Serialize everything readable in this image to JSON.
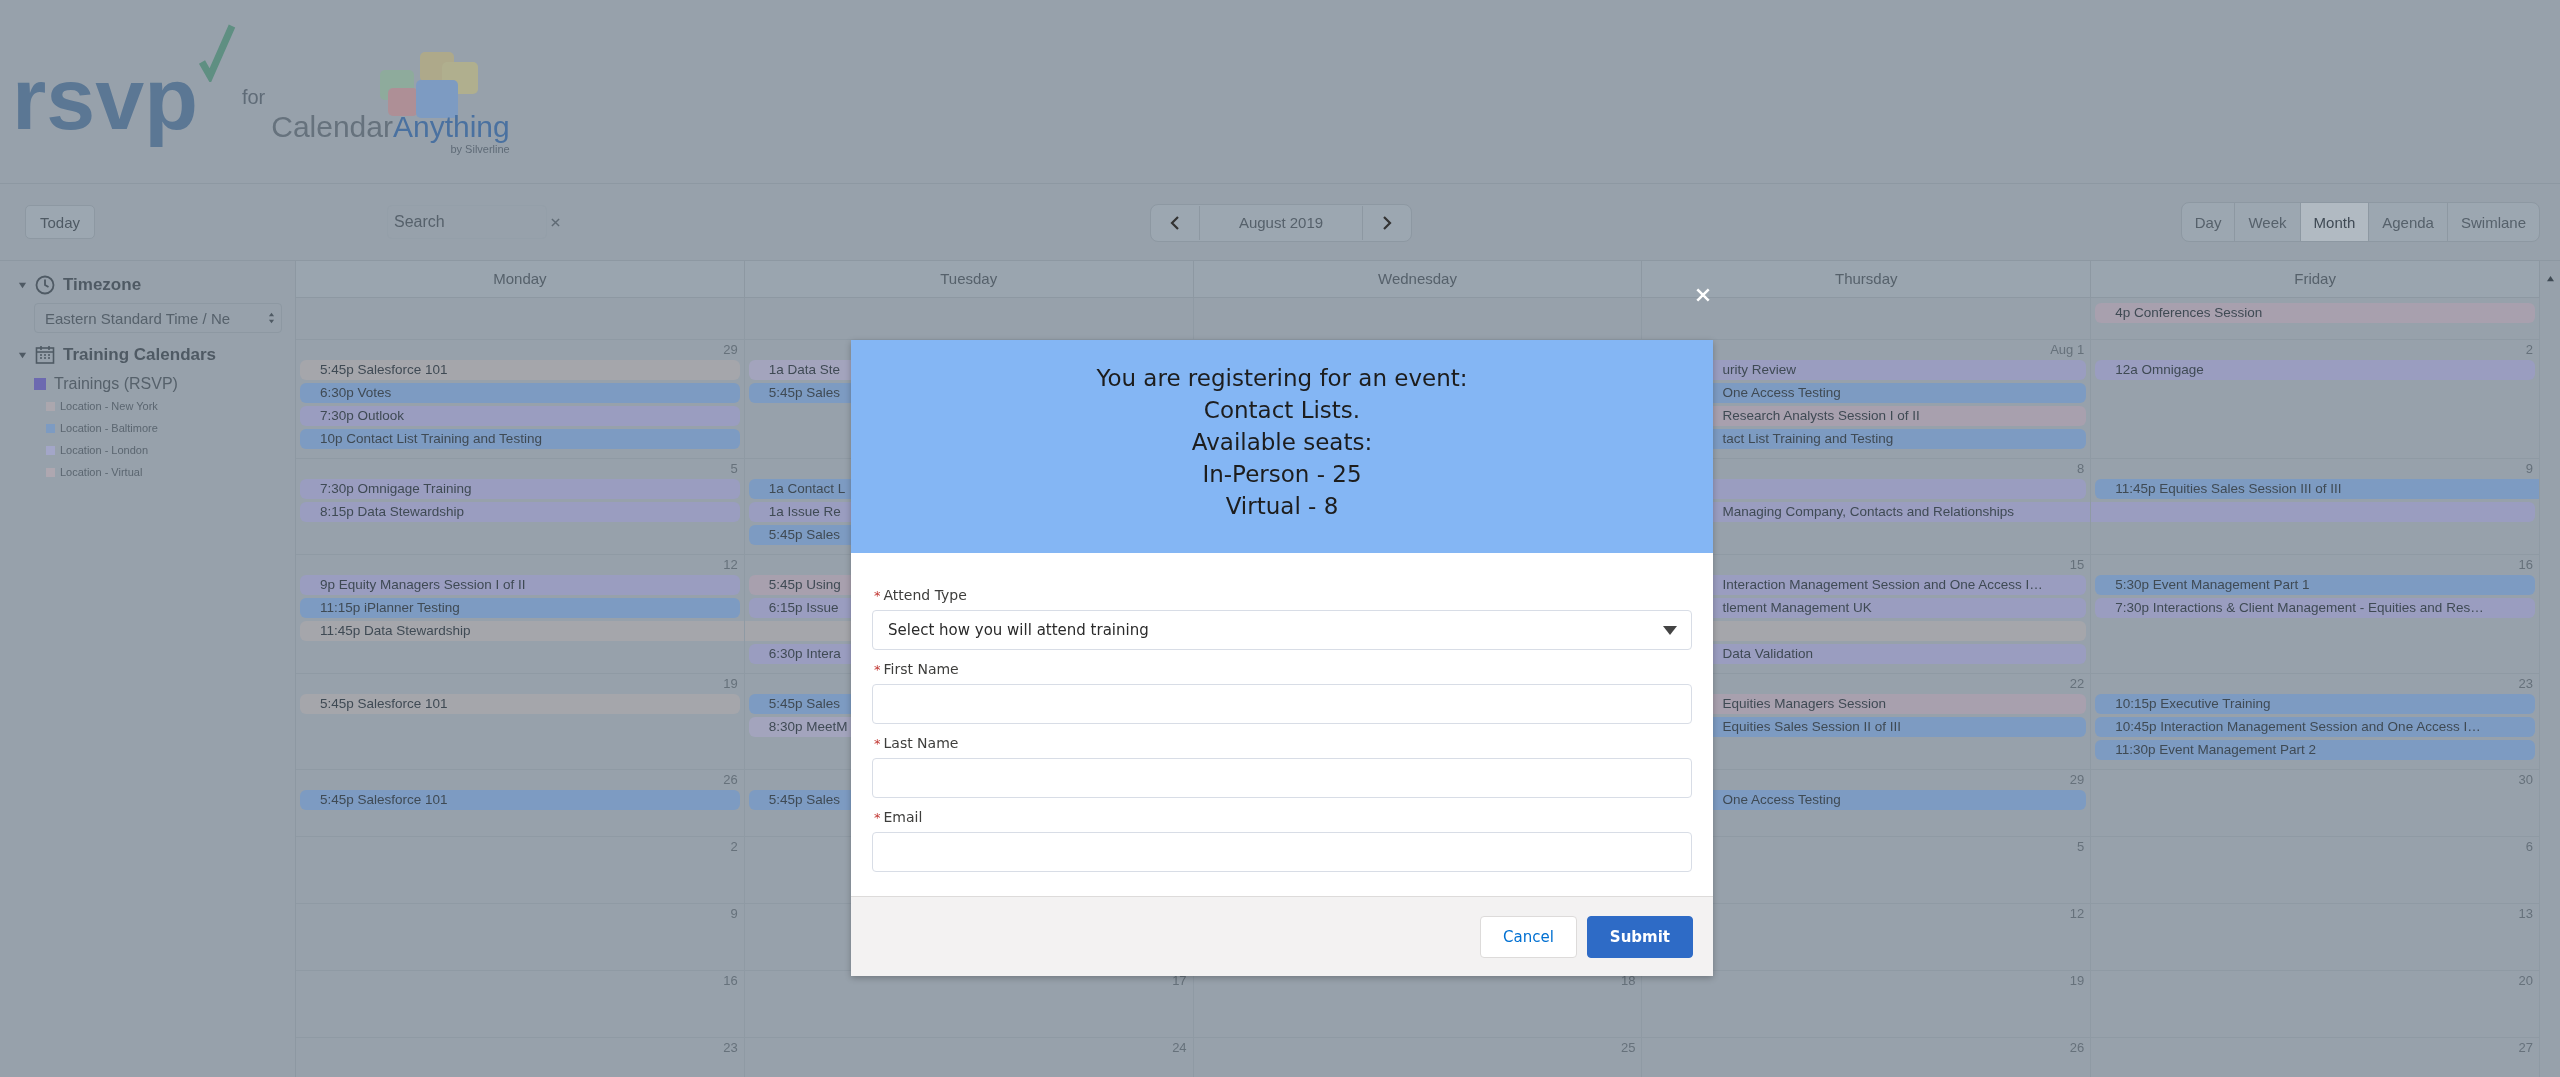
{
  "header": {
    "logo": {
      "wordmark": "rsvp",
      "connector": "for",
      "product_light": "Calendar",
      "product_bold": "Anything",
      "byline": "by Silverline"
    }
  },
  "toolbar": {
    "today": "Today",
    "search": {
      "placeholder": "Search"
    },
    "month_nav": {
      "label": "August 2019"
    },
    "views": [
      {
        "label": "Day",
        "selected": false
      },
      {
        "label": "Week",
        "selected": false
      },
      {
        "label": "Month",
        "selected": true
      },
      {
        "label": "Agenda",
        "selected": false
      },
      {
        "label": "Swimlane",
        "selected": false
      }
    ]
  },
  "sidebar": {
    "sections": [
      {
        "kind": "timezone",
        "title": "Timezone",
        "expanded": true,
        "select_value": "Eastern Standard Time / Ne"
      },
      {
        "kind": "calendars",
        "title": "Training Calendars",
        "expanded": true,
        "items": [
          {
            "label": "Trainings (RSVP)",
            "color": "#6c69b0",
            "children": [
              {
                "label": "Location - New York",
                "color": "#aba7ae"
              },
              {
                "label": "Location - Baltimore",
                "color": "#7d9bc2"
              },
              {
                "label": "Location - London",
                "color": "#a3a6c8"
              },
              {
                "label": "Location - Virtual",
                "color": "#aea7b0"
              }
            ]
          }
        ]
      }
    ]
  },
  "calendar": {
    "days": [
      "Monday",
      "Tuesday",
      "Wednesday",
      "Thursday",
      "Friday"
    ],
    "weeks": [
      {
        "cells": [
          {},
          {},
          {},
          {},
          {
            "events": [
              {
                "title": "4p Conferences Session",
                "color": "#a8a0ae",
                "continues_left": false,
                "continues_right": false
              }
            ]
          }
        ]
      },
      {
        "cells": [
          {
            "date": "29",
            "events": [
              {
                "title": "5:45p Salesforce 101",
                "color": "#a5a6ab",
                "continues_left": false,
                "continues_right": false
              },
              {
                "title": "6:30p Votes",
                "color": "#7d9bc2",
                "continues_left": false,
                "continues_right": false
              },
              {
                "title": "7:30p Outlook",
                "color": "#9a9dc0",
                "continues_left": false,
                "continues_right": false
              },
              {
                "title": "10p Contact List Training and Testing",
                "color": "#7d9bc2",
                "continues_left": false,
                "continues_right": false
              }
            ]
          },
          {
            "events": [
              {
                "title": "1a Data Ste",
                "color": "#a3a4bd",
                "continues_left": false,
                "continues_right": false
              },
              {
                "title": "5:45p Sales",
                "color": "#7d9bc2",
                "continues_left": false,
                "continues_right": false
              }
            ]
          },
          {},
          {
            "date": "Aug 1",
            "events": [
              {
                "title": "urity Review",
                "color": "#9a9dc0",
                "continues_left": false,
                "continues_right": false
              },
              {
                "title": "One Access Testing",
                "color": "#7d9bc2",
                "continues_left": false,
                "continues_right": false
              },
              {
                "title": "Research Analysts Session I of II",
                "color": "#a8a0ae",
                "continues_left": false,
                "continues_right": false
              },
              {
                "title": "tact List Training and Testing",
                "color": "#7d9bc2",
                "continues_left": false,
                "continues_right": false
              }
            ]
          },
          {
            "date": "2",
            "events": [
              {
                "title": "12a Omnigage",
                "color": "#9a9dc0",
                "continues_left": false,
                "continues_right": false
              }
            ]
          }
        ]
      },
      {
        "cells": [
          {
            "date": "5",
            "events": [
              {
                "title": "7:30p Omnigage Training",
                "color": "#9a9dc0",
                "continues_left": false,
                "continues_right": false
              },
              {
                "title": "8:15p Data Stewardship",
                "color": "#9a9dc0",
                "continues_left": false,
                "continues_right": false
              }
            ]
          },
          {
            "events": [
              {
                "title": "1a Contact L",
                "color": "#7d9bc2",
                "continues_left": false,
                "continues_right": false
              },
              {
                "title": "1a Issue Re",
                "color": "#9a9dc0",
                "continues_left": false,
                "continues_right": false
              },
              {
                "title": "5:45p Sales",
                "color": "#7d9bc2",
                "continues_left": false,
                "continues_right": false
              }
            ]
          },
          {},
          {
            "date": "8",
            "events": [
              {
                "color": "#9a9dc0",
                "continues_left": false,
                "continues_right": false
              },
              {
                "title": "Managing Company, Contacts and Relationships",
                "color": "#9a9dc0",
                "continues_left": false,
                "continues_right": true
              }
            ]
          },
          {
            "date": "9",
            "events": [
              {
                "title": "11:45p Equities Sales Session III of III",
                "color": "#7d9bc2",
                "continues_left": false,
                "continues_right": true
              },
              {
                "color": "#9a9dc0",
                "continues_left": true,
                "continues_right": false
              }
            ]
          }
        ]
      },
      {
        "cells": [
          {
            "date": "12",
            "events": [
              {
                "title": "9p Equity Managers Session I of II",
                "color": "#9a9dc0",
                "continues_left": false,
                "continues_right": false
              },
              {
                "title": "11:15p iPlanner Testing",
                "color": "#7d9bc2",
                "continues_left": false,
                "continues_right": false
              },
              {
                "title": "11:45p Data Stewardship",
                "color": "#a5a6ab",
                "continues_left": false,
                "continues_right": true
              }
            ]
          },
          {
            "events": [
              {
                "title": "5:45p Using",
                "color": "#a8a0ae",
                "continues_left": false,
                "continues_right": false
              },
              {
                "title": "6:15p Issue",
                "color": "#9a9dc0",
                "continues_left": false,
                "continues_right": false
              },
              {
                "color": "#a5a6ab",
                "continues_left": true,
                "continues_right": true
              },
              {
                "title": "6:30p Intera",
                "color": "#9a9dc0",
                "continues_left": false,
                "continues_right": false
              }
            ]
          },
          {},
          {
            "date": "15",
            "events": [
              {
                "title": "Interaction Management Session and One Access I…",
                "color": "#9a9dc0",
                "continues_left": false,
                "continues_right": false
              },
              {
                "title": "tlement Management UK",
                "color": "#9a9dc0",
                "continues_left": false,
                "continues_right": false
              },
              {
                "color": "#a5a6ab",
                "continues_left": true,
                "continues_right": false
              },
              {
                "title": "Data Validation",
                "color": "#9a9dc0",
                "continues_left": false,
                "continues_right": false
              }
            ]
          },
          {
            "date": "16",
            "events": [
              {
                "title": "5:30p Event Management Part 1",
                "color": "#7d9bc2",
                "continues_left": false,
                "continues_right": false
              },
              {
                "title": "7:30p Interactions & Client Management - Equities and Res…",
                "color": "#9a9dc0",
                "continues_left": false,
                "continues_right": false
              }
            ]
          }
        ]
      },
      {
        "cells": [
          {
            "date": "19",
            "events": [
              {
                "title": "5:45p Salesforce 101",
                "color": "#a5a6ab",
                "continues_left": false,
                "continues_right": false
              }
            ]
          },
          {
            "events": [
              {
                "title": "5:45p Sales",
                "color": "#7d9bc2",
                "continues_left": false,
                "continues_right": false
              },
              {
                "title": "8:30p MeetM",
                "color": "#a3a4bd",
                "continues_left": false,
                "continues_right": false
              }
            ]
          },
          {},
          {
            "date": "22",
            "events": [
              {
                "title": "Equities Managers Session",
                "color": "#a8a0ae",
                "continues_left": false,
                "continues_right": false
              },
              {
                "title": "Equities Sales Session II of III",
                "color": "#7d9bc2",
                "continues_left": false,
                "continues_right": false
              }
            ]
          },
          {
            "date": "23",
            "events": [
              {
                "title": "10:15p Executive Training",
                "color": "#7d9bc2",
                "continues_left": false,
                "continues_right": false
              },
              {
                "title": "10:45p Interaction Management Session and One Access I…",
                "color": "#7d9bc2",
                "continues_left": false,
                "continues_right": false
              },
              {
                "title": "11:30p Event Management Part 2",
                "color": "#7d9bc2",
                "continues_left": false,
                "continues_right": false
              }
            ]
          }
        ]
      },
      {
        "cells": [
          {
            "date": "26",
            "events": [
              {
                "title": "5:45p Salesforce 101",
                "color": "#7d9bc2",
                "continues_left": false,
                "continues_right": false
              }
            ]
          },
          {
            "events": [
              {
                "title": "5:45p Sales",
                "color": "#7d9bc2",
                "continues_left": false,
                "continues_right": false
              }
            ]
          },
          {},
          {
            "date": "29",
            "events": [
              {
                "title": "One Access Testing",
                "color": "#7d9bc2",
                "continues_left": false,
                "continues_right": false
              }
            ]
          },
          {
            "date": "30"
          }
        ]
      },
      {
        "cells": [
          {
            "date": "2"
          },
          {},
          {},
          {
            "date": "5"
          },
          {
            "date": "6"
          }
        ]
      },
      {
        "cells": [
          {
            "date": "9"
          },
          {},
          {},
          {
            "date": "12"
          },
          {
            "date": "13"
          }
        ]
      },
      {
        "cells": [
          {
            "date": "16"
          },
          {
            "date": "17"
          },
          {
            "date": "18"
          },
          {
            "date": "19"
          },
          {
            "date": "20"
          }
        ]
      },
      {
        "cells": [
          {
            "date": "23"
          },
          {
            "date": "24"
          },
          {
            "date": "25"
          },
          {
            "date": "26"
          },
          {
            "date": "27"
          }
        ]
      }
    ]
  },
  "modal": {
    "header_lines": [
      "You are registering for an event:",
      "Contact Lists.",
      "Available seats:",
      "In-Person - 25",
      "Virtual - 8"
    ],
    "fields": [
      {
        "kind": "select",
        "marker": "*",
        "label": "Attend Type",
        "placeholder": "Select how you will attend training"
      },
      {
        "kind": "text",
        "marker": "*",
        "label": "First Name"
      },
      {
        "kind": "text",
        "marker": "*",
        "label": "Last Name"
      },
      {
        "kind": "text",
        "marker": "*",
        "label": "Email"
      }
    ],
    "buttons": [
      {
        "kind": "neutral",
        "label": "Cancel"
      },
      {
        "kind": "brand",
        "label": "Submit"
      }
    ]
  }
}
